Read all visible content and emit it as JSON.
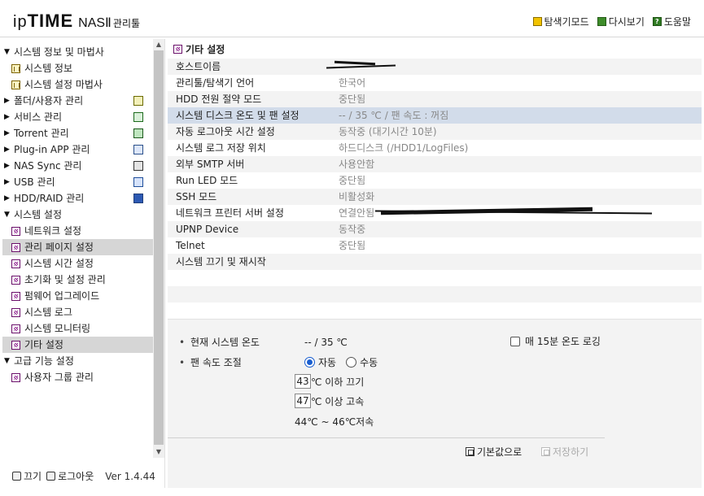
{
  "header": {
    "logo_ip": "ip",
    "logo_time": "TIME",
    "logo_nas": "NASⅡ",
    "logo_tool": "관리툴",
    "links": [
      {
        "label": "탐색기모드",
        "icon": "explorer-icon"
      },
      {
        "label": "다시보기",
        "icon": "refresh-icon"
      },
      {
        "label": "도움말",
        "icon": "help-icon"
      }
    ]
  },
  "sidebar": {
    "items": [
      {
        "label": "시스템 정보 및 마법사",
        "level": 0,
        "expanded": true
      },
      {
        "label": "시스템 정보",
        "level": 1,
        "icon": "chart-icon"
      },
      {
        "label": "시스템 설정 마법사",
        "level": 1,
        "icon": "chart-icon"
      },
      {
        "label": "폴더/사용자 관리",
        "level": 0,
        "expanded": false,
        "right_icon": "folder"
      },
      {
        "label": "서비스 관리",
        "level": 0,
        "expanded": false,
        "right_icon": "svc"
      },
      {
        "label": "Torrent 관리",
        "level": 0,
        "expanded": false,
        "right_icon": "torrent"
      },
      {
        "label": "Plug-in APP 관리",
        "level": 0,
        "expanded": false,
        "right_icon": "plug"
      },
      {
        "label": "NAS Sync 관리",
        "level": 0,
        "expanded": false,
        "right_icon": "sync"
      },
      {
        "label": "USB 관리",
        "level": 0,
        "expanded": false,
        "right_icon": "usb"
      },
      {
        "label": "HDD/RAID 관리",
        "level": 0,
        "expanded": false,
        "right_icon": "hdd"
      },
      {
        "label": "시스템 설정",
        "level": 0,
        "expanded": true
      },
      {
        "label": "네트워크 설정",
        "level": 1,
        "icon": "grid-icon"
      },
      {
        "label": "관리 페이지 설정",
        "level": 1,
        "icon": "grid-icon",
        "selected": true
      },
      {
        "label": "시스템 시간 설정",
        "level": 1,
        "icon": "grid-icon"
      },
      {
        "label": "초기화 및 설정 관리",
        "level": 1,
        "icon": "grid-icon"
      },
      {
        "label": "펌웨어 업그레이드",
        "level": 1,
        "icon": "grid-icon"
      },
      {
        "label": "시스템 로그",
        "level": 1,
        "icon": "grid-icon"
      },
      {
        "label": "시스템 모니터링",
        "level": 1,
        "icon": "grid-icon"
      },
      {
        "label": "기타 설정",
        "level": 1,
        "icon": "grid-icon",
        "selected": true
      },
      {
        "label": "고급 기능 설정",
        "level": 0,
        "expanded": true
      },
      {
        "label": "사용자 그룹 관리",
        "level": 1,
        "icon": "grid-icon"
      }
    ],
    "footer": {
      "power_label": "끄기",
      "logout_label": "로그아웃",
      "version": "Ver 1.4.44"
    }
  },
  "main": {
    "title": "기타 설정",
    "settings": [
      {
        "key": "호스트이름",
        "value": ""
      },
      {
        "key": "관리툴/탐색기 언어",
        "value": "한국어"
      },
      {
        "key": "HDD 전원 절약 모드",
        "value": "중단됨"
      },
      {
        "key": "시스템 디스크 온도 및 팬 설정",
        "value": "-- / 35 ℃ / 팬 속도 : 꺼짐",
        "highlight": true
      },
      {
        "key": "자동 로그아웃 시간 설정",
        "value": "동작중 (대기시간 10분)"
      },
      {
        "key": "시스템 로그 저장 위치",
        "value": "하드디스크 (/HDD1/LogFiles)"
      },
      {
        "key": "외부 SMTP 서버",
        "value": "사용안함"
      },
      {
        "key": "Run LED 모드",
        "value": "중단됨"
      },
      {
        "key": "SSH 모드",
        "value": "비활성화"
      },
      {
        "key": "네트워크 프린터 서버 설정",
        "value": "연결안됨"
      },
      {
        "key": "UPNP Device",
        "value": "동작중"
      },
      {
        "key": "Telnet",
        "value": "중단됨"
      },
      {
        "key": "시스템 끄기 및 재시작",
        "value": ""
      }
    ],
    "detail": {
      "current_temp_label": "현재 시스템 온도",
      "current_temp_value": "-- / 35 ℃",
      "log_checkbox_label": "매 15분 온도 로깅",
      "fan_label": "팬 속도 조절",
      "radio_auto": "자동",
      "radio_manual": "수동",
      "low_value": "43",
      "low_label": "℃ 이하 끄기",
      "high_value": "47",
      "high_label": "℃ 이상 고속",
      "range_text": "44℃ ~ 46℃저속",
      "default_button": "기본값으로",
      "save_button": "저장하기"
    }
  }
}
